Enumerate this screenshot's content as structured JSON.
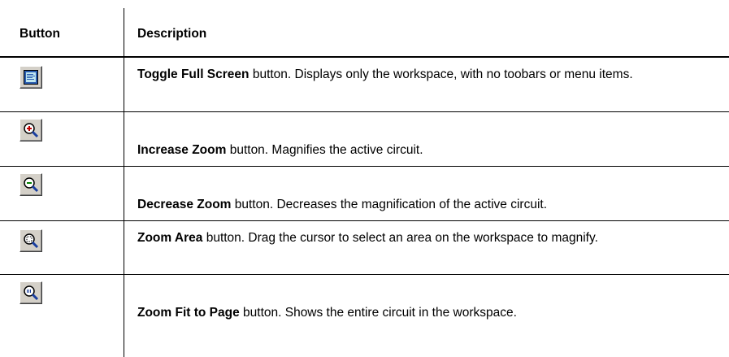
{
  "header": {
    "col_button": "Button",
    "col_description": "Description"
  },
  "rows": [
    {
      "icon": "toggle-full-screen-icon",
      "title": "Toggle Full Screen",
      "text": " button. Displays only the workspace, with no toobars or menu items."
    },
    {
      "icon": "increase-zoom-icon",
      "title": "Increase Zoom",
      "text": " button. Magnifies the active circuit."
    },
    {
      "icon": "decrease-zoom-icon",
      "title": "Decrease Zoom",
      "text": " button. Decreases the magnification of the active circuit."
    },
    {
      "icon": "zoom-area-icon",
      "title": "Zoom Area",
      "text": " button. Drag the cursor to select an area on the workspace to magnify."
    },
    {
      "icon": "zoom-fit-to-page-icon",
      "title": "Zoom Fit to Page",
      "text": " button. Shows the entire circuit in the workspace."
    }
  ]
}
